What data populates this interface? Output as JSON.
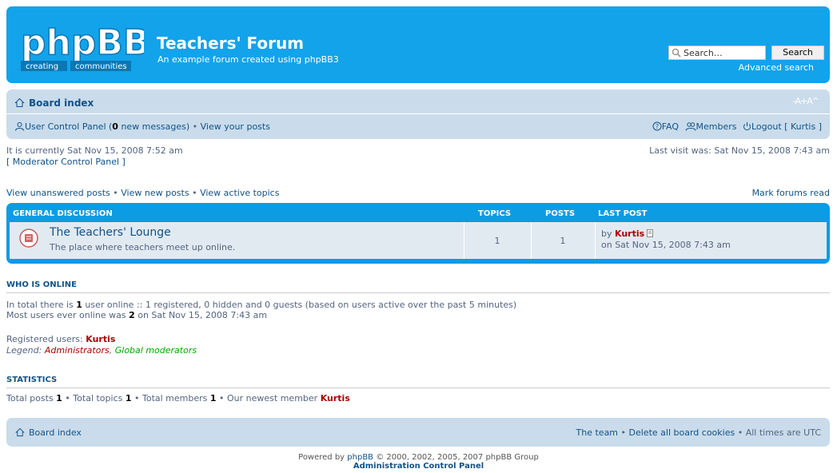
{
  "header": {
    "logo_text": "phpBB",
    "logo_tagline_left": "creating",
    "logo_tagline_right": "communities",
    "title": "Teachers' Forum",
    "description": "An example forum created using phpBB3",
    "search_placeholder": "Search…",
    "search_button": "Search",
    "advanced_search": "Advanced search"
  },
  "navbar": {
    "board_index": "Board index",
    "font_resize": "-A+A^",
    "ucp_label": "User Control Panel (",
    "new_messages_count": "0",
    "new_messages_suffix": " new messages)",
    "sep": " • ",
    "view_posts": "View your posts",
    "faq": "FAQ",
    "members": "Members",
    "logout": "Logout [ Kurtis ]"
  },
  "meta": {
    "current_time": "It is currently Sat Nov 15, 2008 7:52 am",
    "mcp": "[ Moderator Control Panel ]",
    "last_visit": "Last visit was: Sat Nov 15, 2008 7:43 am"
  },
  "links": {
    "unanswered": "View unanswered posts",
    "new_posts": "View new posts",
    "active_topics": "View active topics",
    "sep": " • ",
    "mark_read": "Mark forums read"
  },
  "forum_table": {
    "headers": {
      "category": "GENERAL DISCUSSION",
      "topics": "TOPICS",
      "posts": "POSTS",
      "last_post": "LAST POST"
    },
    "rows": [
      {
        "title": "The Teachers' Lounge",
        "description": "The place where teachers meet up online.",
        "topics": "1",
        "posts": "1",
        "last_post_by": "by ",
        "last_post_user": "Kurtis",
        "last_post_time": "on Sat Nov 15, 2008 7:43 am"
      }
    ]
  },
  "who_is_online": {
    "title": "WHO IS ONLINE",
    "line1_pre": "In total there is ",
    "line1_count": "1",
    "line1_post": " user online :: 1 registered, 0 hidden and 0 guests (based on users active over the past 5 minutes)",
    "line2_pre": "Most users ever online was ",
    "line2_count": "2",
    "line2_post": " on Sat Nov 15, 2008 7:43 am",
    "registered_label": "Registered users: ",
    "registered_user": "Kurtis",
    "legend_label": "Legend: ",
    "legend_admins": "Administrators",
    "legend_sep": ", ",
    "legend_mods": "Global moderators"
  },
  "statistics": {
    "title": "STATISTICS",
    "posts_label": "Total posts ",
    "posts": "1",
    "topics_label": " • Total topics ",
    "topics": "1",
    "members_label": " • Total members ",
    "members": "1",
    "newest_label": " • Our newest member ",
    "newest": "Kurtis"
  },
  "footer": {
    "board_index": "Board index",
    "team": "The team",
    "sep": " • ",
    "delete_cookies": "Delete all board cookies",
    "timezone": "All times are UTC",
    "powered_pre": "Powered by ",
    "powered_link": "phpBB",
    "powered_post": " © 2000, 2002, 2005, 2007 phpBB Group",
    "acp": "Administration Control Panel"
  },
  "colors": {
    "header_blue": "#12a3eb",
    "nav_bg": "#cadceb",
    "link_blue": "#105289",
    "user_red": "#aa0000",
    "mod_green": "#00aa00"
  }
}
